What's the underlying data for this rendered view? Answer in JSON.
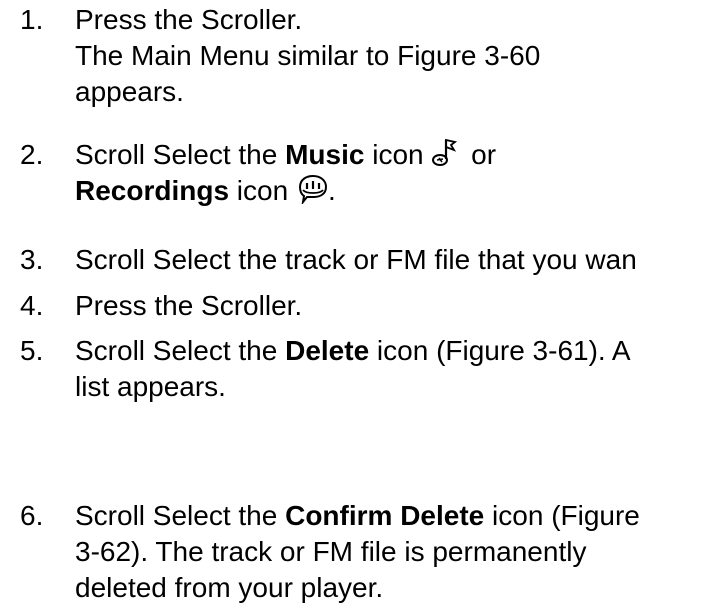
{
  "steps": [
    {
      "number": "1.",
      "lines": [
        "Press the Scroller.",
        "The Main Menu similar to Figure 3-60",
        "appears."
      ]
    },
    {
      "number": "2.",
      "pre": "Scroll Select the ",
      "bold1": "Music",
      "mid": " icon",
      "post": " or",
      "bold2": "Recordings",
      "mid2": " icon",
      "end": ".",
      "icons": [
        "music-note-icon",
        "speech-bubble-icon"
      ]
    },
    {
      "number": "3.",
      "lines": [
        "Scroll Select the track or FM file that you wan"
      ]
    },
    {
      "number": "4.",
      "lines": [
        "Press the Scroller."
      ]
    },
    {
      "number": "5.",
      "pre": "Scroll Select the ",
      "bold": "Delete",
      "post": " icon (Figure 3-61). A",
      "line2": "list appears."
    },
    {
      "number": "6.",
      "pre": "Scroll Select the ",
      "bold": "Confirm Delete",
      "post": " icon (Figure",
      "line2": "3-62). The track or FM file is permanently",
      "line3": "deleted from your player."
    }
  ]
}
